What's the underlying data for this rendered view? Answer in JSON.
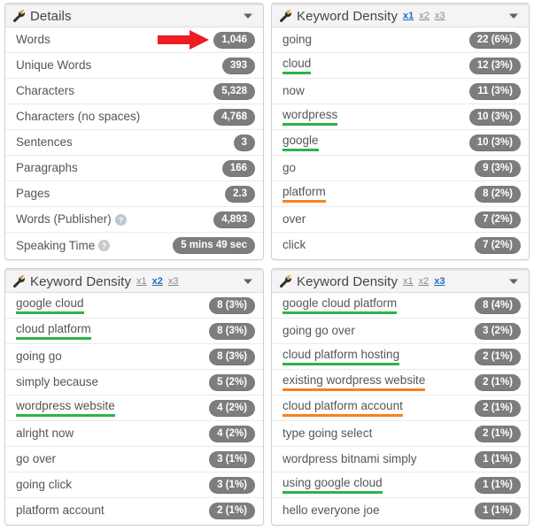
{
  "colors": {
    "badge_gray": "#7d7d7d",
    "highlight_green": "#2cb34a",
    "highlight_orange": "#f58220",
    "active_link_blue": "#1a6fc4",
    "annotation_red": "#ee1c25",
    "header_bg": "#f4f4f4"
  },
  "panels": {
    "details": {
      "title": "Details",
      "wrench_icon": "wrench-icon",
      "collapse_icon": "chevron-down-icon",
      "rows": [
        {
          "label": "Words",
          "value": "1,046",
          "help": false,
          "annotation": "red-arrow-icon"
        },
        {
          "label": "Unique Words",
          "value": "393",
          "help": false
        },
        {
          "label": "Characters",
          "value": "5,328",
          "help": false
        },
        {
          "label": "Characters (no spaces)",
          "value": "4,768",
          "help": false
        },
        {
          "label": "Sentences",
          "value": "3",
          "help": false
        },
        {
          "label": "Paragraphs",
          "value": "166",
          "help": false
        },
        {
          "label": "Pages",
          "value": "2.3",
          "help": false
        },
        {
          "label": "Words (Publisher)",
          "value": "4,893",
          "help": true
        },
        {
          "label": "Speaking Time",
          "value": "5 mins 49 sec",
          "help": true
        }
      ]
    },
    "keyword_density_x1": {
      "title": "Keyword Density",
      "wrench_icon": "wrench-icon",
      "collapse_icon": "chevron-down-icon",
      "links": [
        {
          "label": "x1",
          "active": true
        },
        {
          "label": "x2",
          "active": false
        },
        {
          "label": "x3",
          "active": false
        }
      ],
      "rows": [
        {
          "label": "going",
          "value": "22 (6%)",
          "highlight": "none"
        },
        {
          "label": "cloud",
          "value": "12 (3%)",
          "highlight": "green"
        },
        {
          "label": "now",
          "value": "11 (3%)",
          "highlight": "none"
        },
        {
          "label": "wordpress",
          "value": "10 (3%)",
          "highlight": "green"
        },
        {
          "label": "google",
          "value": "10 (3%)",
          "highlight": "green"
        },
        {
          "label": "go",
          "value": "9 (3%)",
          "highlight": "none"
        },
        {
          "label": "platform",
          "value": "8 (2%)",
          "highlight": "orange"
        },
        {
          "label": "over",
          "value": "7 (2%)",
          "highlight": "none"
        },
        {
          "label": "click",
          "value": "7 (2%)",
          "highlight": "none"
        }
      ]
    },
    "keyword_density_x2": {
      "title": "Keyword Density",
      "wrench_icon": "wrench-icon",
      "collapse_icon": "chevron-down-icon",
      "links": [
        {
          "label": "x1",
          "active": false
        },
        {
          "label": "x2",
          "active": true
        },
        {
          "label": "x3",
          "active": false
        }
      ],
      "rows": [
        {
          "label": "google cloud",
          "value": "8 (3%)",
          "highlight": "green"
        },
        {
          "label": "cloud platform",
          "value": "8 (3%)",
          "highlight": "green"
        },
        {
          "label": "going go",
          "value": "8 (3%)",
          "highlight": "none"
        },
        {
          "label": "simply because",
          "value": "5 (2%)",
          "highlight": "none"
        },
        {
          "label": "wordpress website",
          "value": "4 (2%)",
          "highlight": "green"
        },
        {
          "label": "alright now",
          "value": "4 (2%)",
          "highlight": "none"
        },
        {
          "label": "go over",
          "value": "3 (1%)",
          "highlight": "none"
        },
        {
          "label": "going click",
          "value": "3 (1%)",
          "highlight": "none"
        },
        {
          "label": "platform account",
          "value": "2 (1%)",
          "highlight": "none"
        }
      ]
    },
    "keyword_density_x3": {
      "title": "Keyword Density",
      "wrench_icon": "wrench-icon",
      "collapse_icon": "chevron-down-icon",
      "links": [
        {
          "label": "x1",
          "active": false
        },
        {
          "label": "x2",
          "active": false
        },
        {
          "label": "x3",
          "active": true
        }
      ],
      "rows": [
        {
          "label": "google cloud platform",
          "value": "8 (4%)",
          "highlight": "green"
        },
        {
          "label": "going go over",
          "value": "3 (2%)",
          "highlight": "none"
        },
        {
          "label": "cloud platform hosting",
          "value": "2 (1%)",
          "highlight": "green"
        },
        {
          "label": "existing wordpress website",
          "value": "2 (1%)",
          "highlight": "orange"
        },
        {
          "label": "cloud platform account",
          "value": "2 (1%)",
          "highlight": "orange"
        },
        {
          "label": "type going select",
          "value": "2 (1%)",
          "highlight": "none"
        },
        {
          "label": "wordpress bitnami simply",
          "value": "1 (1%)",
          "highlight": "none"
        },
        {
          "label": "using google cloud",
          "value": "1 (1%)",
          "highlight": "green"
        },
        {
          "label": "hello everyone joe",
          "value": "1 (1%)",
          "highlight": "none"
        }
      ]
    }
  }
}
